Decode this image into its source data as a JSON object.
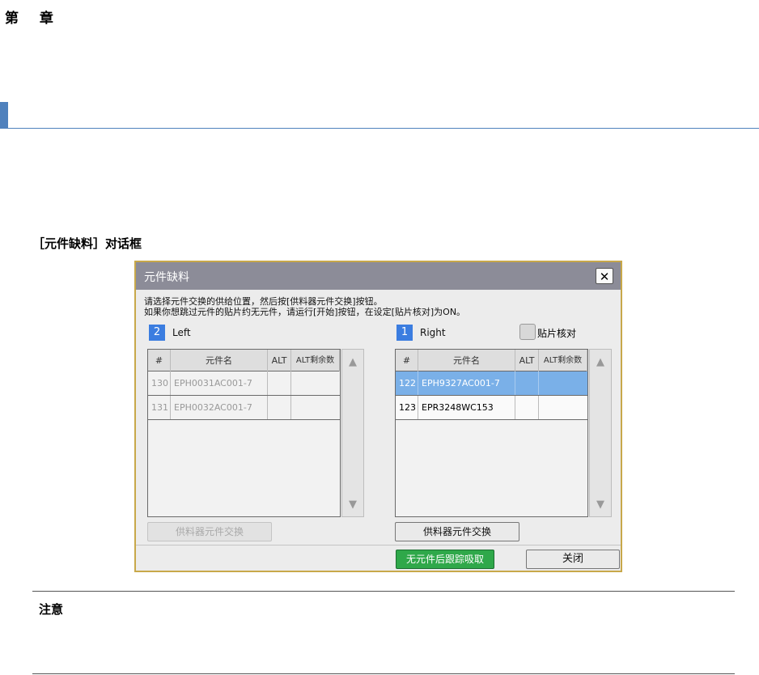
{
  "page": {
    "chapter": "第 章",
    "caption": "［元件缺料］对话框",
    "note_title": "注意"
  },
  "dialog": {
    "title": "元件缺料",
    "message_line1": "请选择元件交换的供给位置，然后按[供料器元件交换]按钮。",
    "message_line2": "如果你想跳过元件的贴片约无元件，请运行[开始]按钮，在设定[贴片核对]为ON。",
    "placement_check_label": "贴片核对",
    "left_panel": {
      "badge": "2",
      "label": "Left",
      "headers": [
        "#",
        "元件名",
        "ALT",
        "ALT剩余数"
      ],
      "rows": [
        {
          "num": "130",
          "part": "EPH0031AC001-7",
          "alt": "",
          "alt_remaining": ""
        },
        {
          "num": "131",
          "part": "EPH0032AC001-7",
          "alt": "",
          "alt_remaining": ""
        }
      ],
      "exchange_button": "供料器元件交换"
    },
    "right_panel": {
      "badge": "1",
      "label": "Right",
      "headers": [
        "#",
        "元件名",
        "ALT",
        "ALT剩余数"
      ],
      "rows": [
        {
          "num": "122",
          "part": "EPH9327AC001-7",
          "alt": "",
          "alt_remaining": ""
        },
        {
          "num": "123",
          "part": "EPR3248WC153",
          "alt": "",
          "alt_remaining": ""
        }
      ],
      "exchange_button": "供料器元件交换"
    },
    "track_button": "无元件后跟踪吸取",
    "close_button": "关闭"
  },
  "icons": {
    "close": "close-icon",
    "scroll_up": "arrow-up-icon",
    "scroll_down": "arrow-down-icon"
  },
  "colors": {
    "accent": "#4f81bd",
    "badge": "#3b7de0",
    "selected_row": "#7ab0e8",
    "green_button": "#2fa84a",
    "titlebar": "#8c8c98"
  }
}
